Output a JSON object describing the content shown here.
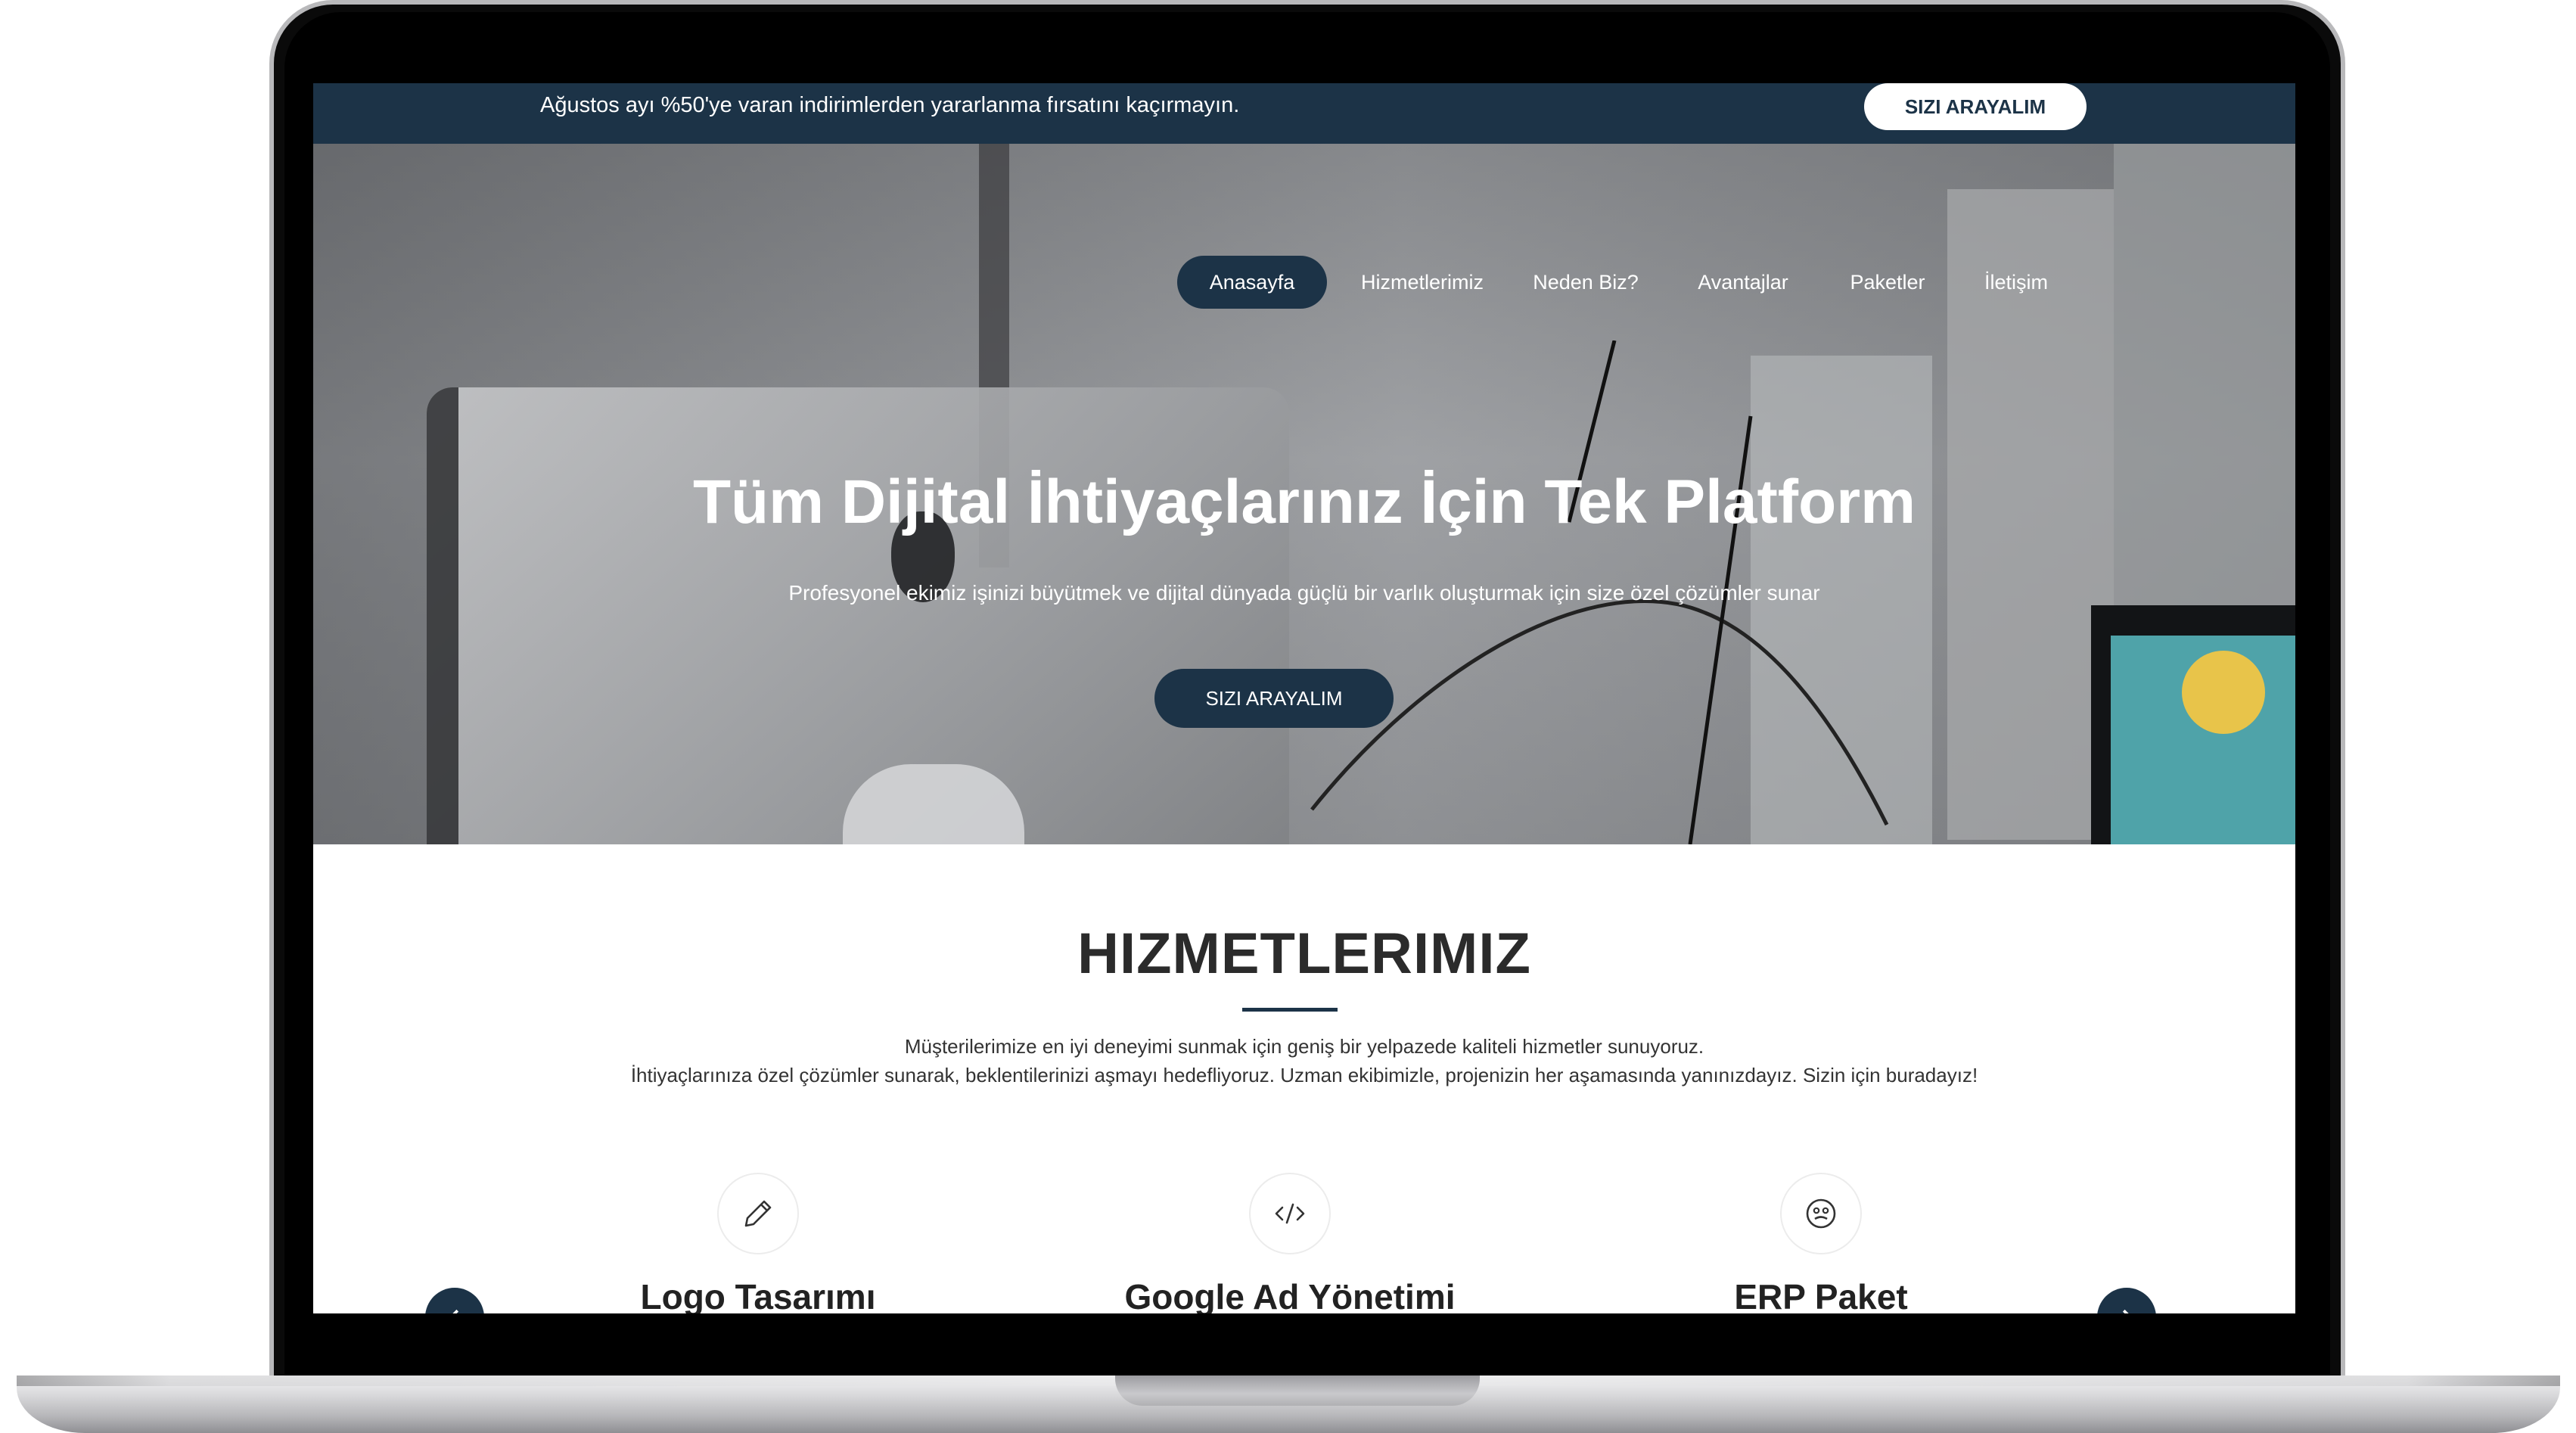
{
  "topbar": {
    "promo_text": "Ağustos ayı %50'ye varan indirimlerden yararlanma fırsatını kaçırmayın.",
    "cta_label": "SIZI ARAYALIM"
  },
  "nav": {
    "items": [
      {
        "label": "Anasayfa",
        "active": true
      },
      {
        "label": "Hizmetlerimiz",
        "active": false
      },
      {
        "label": "Neden Biz?",
        "active": false
      },
      {
        "label": "Avantajlar",
        "active": false
      },
      {
        "label": "Paketler",
        "active": false
      },
      {
        "label": "İletişim",
        "active": false
      }
    ]
  },
  "hero": {
    "title": "Tüm Dijital İhtiyaçlarınız İçin Tek Platform",
    "subtitle": "Profesyonel ekimiz işinizi büyütmek ve dijital dünyada güçlü bir varlık oluşturmak için size özel çözümler sunar",
    "cta_label": "SIZI ARAYALIM"
  },
  "services": {
    "title": "HIZMETLERIMIZ",
    "description_line1": "Müşterilerimize en iyi deneyimi sunmak için geniş bir yelpazede kaliteli hizmetler sunuyoruz.",
    "description_line2": "İhtiyaçlarınıza özel çözümler sunarak, beklentilerinizi aşmayı hedefliyoruz. Uzman ekibimizle, projenizin her aşamasında yanınızdayız. Sizin için buradayız!",
    "items": [
      {
        "name": "Logo Tasarımı",
        "icon": "pencil-icon"
      },
      {
        "name": "Google Ad Yönetimi",
        "icon": "code-icon"
      },
      {
        "name": "ERP Paket",
        "icon": "face-icon"
      }
    ]
  },
  "colors": {
    "primary": "#1c3347",
    "text_dark": "#2b2b2b",
    "white": "#ffffff"
  }
}
